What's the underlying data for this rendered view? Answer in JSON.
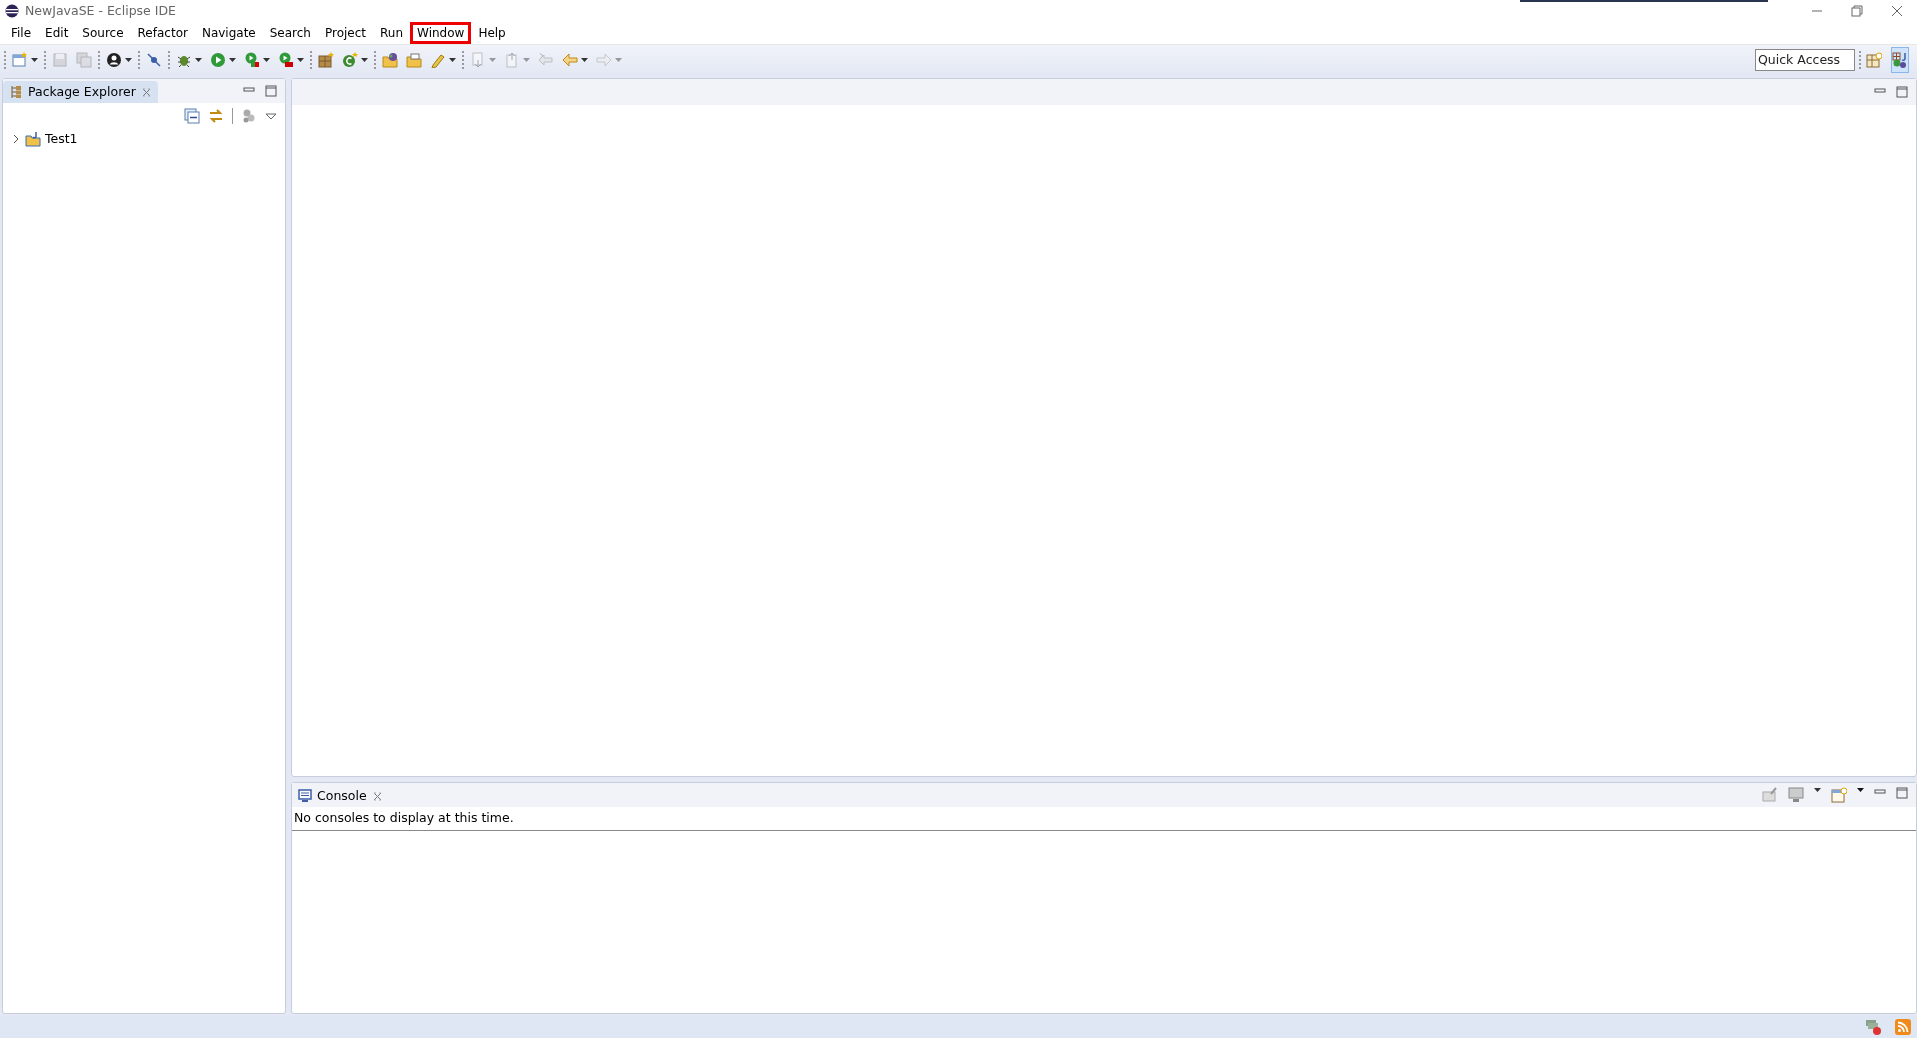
{
  "window": {
    "title": "NewJavaSE - Eclipse IDE"
  },
  "menu": [
    {
      "label": "File",
      "highlighted": false
    },
    {
      "label": "Edit",
      "highlighted": false
    },
    {
      "label": "Source",
      "highlighted": false
    },
    {
      "label": "Refactor",
      "highlighted": false
    },
    {
      "label": "Navigate",
      "highlighted": false
    },
    {
      "label": "Search",
      "highlighted": false
    },
    {
      "label": "Project",
      "highlighted": false
    },
    {
      "label": "Run",
      "highlighted": false
    },
    {
      "label": "Window",
      "highlighted": true
    },
    {
      "label": "Help",
      "highlighted": false
    }
  ],
  "toolbar_groups": [
    [
      {
        "disabled": false,
        "dropdown": true
      }
    ],
    [
      {
        "disabled": true,
        "dropdown": false
      },
      {
        "disabled": true,
        "dropdown": false
      }
    ],
    [
      {
        "disabled": false,
        "dropdown": true
      }
    ],
    [
      {
        "disabled": false,
        "dropdown": false
      }
    ],
    [
      {
        "disabled": false,
        "dropdown": true
      },
      {
        "disabled": false,
        "dropdown": true
      },
      {
        "disabled": false,
        "dropdown": true
      },
      {
        "disabled": false,
        "dropdown": true
      }
    ],
    [
      {
        "disabled": false,
        "dropdown": false
      },
      {
        "disabled": false,
        "dropdown": true
      }
    ],
    [
      {
        "disabled": false,
        "dropdown": false
      },
      {
        "disabled": false,
        "dropdown": false
      },
      {
        "disabled": false,
        "dropdown": true
      }
    ],
    [
      {
        "disabled": true,
        "dropdown": true
      },
      {
        "disabled": true,
        "dropdown": true
      },
      {
        "disabled": true,
        "dropdown": false
      },
      {
        "disabled": false,
        "dropdown": true
      },
      {
        "disabled": true,
        "dropdown": true
      }
    ]
  ],
  "quick_access": {
    "placeholder": "Quick Access"
  },
  "perspectives": [
    {
      "selected": false
    },
    {
      "selected": true
    }
  ],
  "package_explorer": {
    "tab": {
      "label": "Package Explorer",
      "selected": true
    },
    "tree": [
      {
        "label": "Test1",
        "expanded": false
      }
    ]
  },
  "console": {
    "tab": {
      "label": "Console",
      "selected": false
    },
    "message": "No consoles to display at this time."
  }
}
